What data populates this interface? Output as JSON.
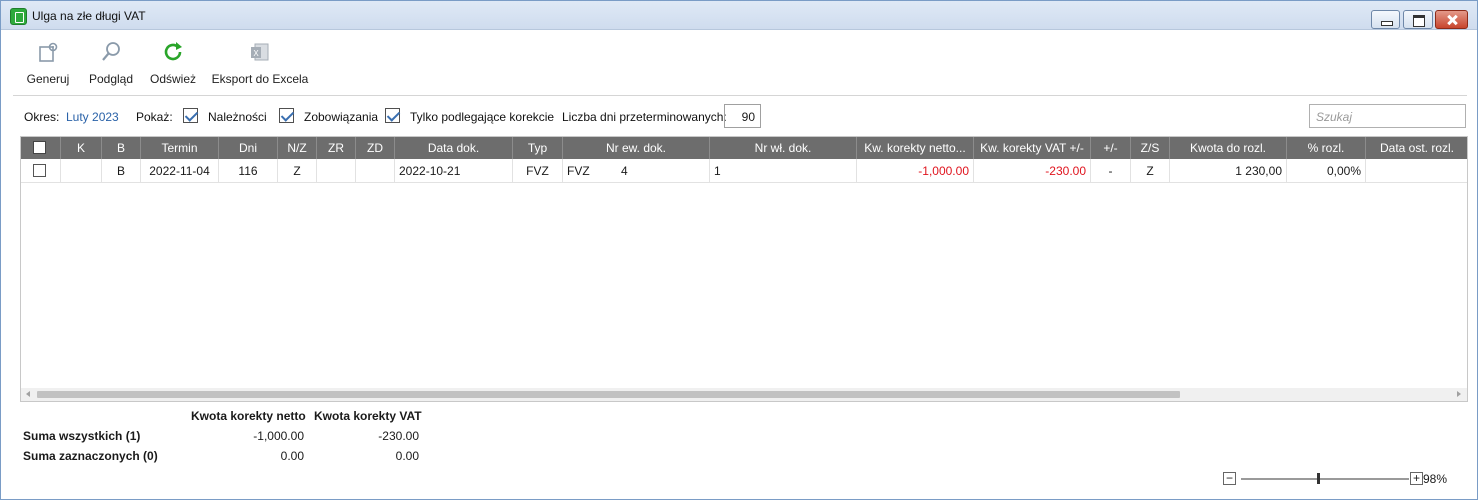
{
  "window": {
    "title": "Ulga na złe długi VAT"
  },
  "toolbar": {
    "generate": "Generuj",
    "preview": "Podgląd",
    "refresh": "Odśwież",
    "export": "Eksport do Excela",
    "icons": [
      "gear-doc-icon",
      "magnifier-icon",
      "refresh-icon",
      "excel-icon"
    ],
    "refresh_color": "#2aa52a"
  },
  "filters": {
    "period_label": "Okres:",
    "period_value": "Luty 2023",
    "show_label": "Pokaż:",
    "receivables": "Należności",
    "liabilities": "Zobowiązania",
    "only_correction": "Tylko podlegające korekcie",
    "days_label": "Liczba dni przeterminowanych:",
    "days_value": "90",
    "search_placeholder": "Szukaj"
  },
  "grid": {
    "columns": [
      "K",
      "B",
      "Termin",
      "Dni",
      "N/Z",
      "ZR",
      "ZD",
      "Data dok.",
      "Typ",
      "Nr ew. dok.",
      "Nr wł. dok.",
      "Kw. korekty netto...",
      "Kw. korekty VAT +/-",
      "+/-",
      "Z/S",
      "Kwota do rozl.",
      "% rozl.",
      "Data ost. rozl."
    ],
    "rows": [
      {
        "k": "",
        "b": "B",
        "termin": "2022-11-04",
        "dni": "116",
        "nz": "Z",
        "zr": "",
        "zd": "",
        "data_dok": "2022-10-21",
        "typ": "FVZ",
        "nr_ew_prefix": "FVZ",
        "nr_ew_num": "4",
        "nr_wl": "1",
        "kw_netto": "-1,000.00",
        "kw_vat": "-230.00",
        "pm": "-",
        "zs": "Z",
        "kwota_rozl": "1 230,00",
        "proc_rozl": "0,00%",
        "data_ost": ""
      }
    ],
    "header_color": "#6d6d6d",
    "negative_color": "#e0141e"
  },
  "summary": {
    "col_netto": "Kwota korekty netto",
    "col_vat": "Kwota korekty VAT",
    "all_label": "Suma wszystkich (1)",
    "all_netto": "-1,000.00",
    "all_vat": "-230.00",
    "sel_label": "Suma zaznaczonych (0)",
    "sel_netto": "0.00",
    "sel_vat": "0.00"
  },
  "zoom": {
    "minus": "−",
    "plus": "+",
    "value": "98%",
    "level": 0.98
  }
}
